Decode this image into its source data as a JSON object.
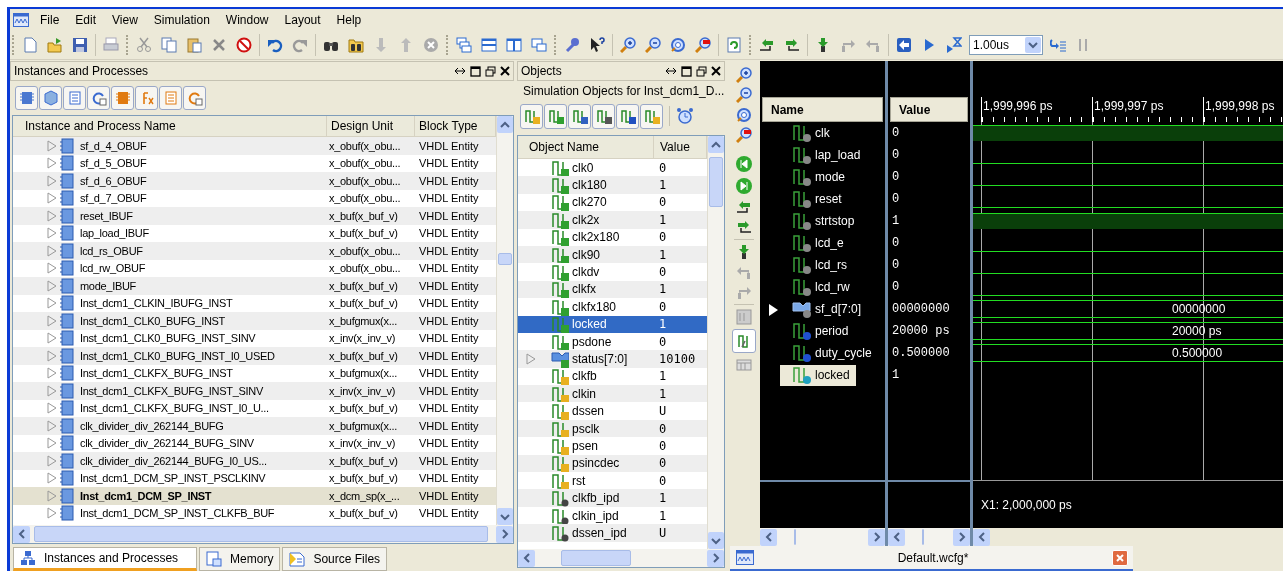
{
  "menu": [
    "File",
    "Edit",
    "View",
    "Simulation",
    "Window",
    "Layout",
    "Help"
  ],
  "toolbar": {
    "time_step": "1.00us"
  },
  "instances": {
    "title": "Instances and Processes",
    "columns": [
      "Instance and Process Name",
      "Design Unit",
      "Block Type"
    ],
    "rows": [
      {
        "name": "sf_d_4_OBUF",
        "design_unit": "x_obuf(x_obu...",
        "block_type": "VHDL Entity",
        "selected": false
      },
      {
        "name": "sf_d_5_OBUF",
        "design_unit": "x_obuf(x_obu...",
        "block_type": "VHDL Entity",
        "selected": false
      },
      {
        "name": "sf_d_6_OBUF",
        "design_unit": "x_obuf(x_obu...",
        "block_type": "VHDL Entity",
        "selected": false
      },
      {
        "name": "sf_d_7_OBUF",
        "design_unit": "x_obuf(x_obu...",
        "block_type": "VHDL Entity",
        "selected": false
      },
      {
        "name": "reset_IBUF",
        "design_unit": "x_buf(x_buf_v)",
        "block_type": "VHDL Entity",
        "selected": false
      },
      {
        "name": "lap_load_IBUF",
        "design_unit": "x_buf(x_buf_v)",
        "block_type": "VHDL Entity",
        "selected": false
      },
      {
        "name": "lcd_rs_OBUF",
        "design_unit": "x_obuf(x_obu...",
        "block_type": "VHDL Entity",
        "selected": false
      },
      {
        "name": "lcd_rw_OBUF",
        "design_unit": "x_obuf(x_obu...",
        "block_type": "VHDL Entity",
        "selected": false
      },
      {
        "name": "mode_IBUF",
        "design_unit": "x_buf(x_buf_v)",
        "block_type": "VHDL Entity",
        "selected": false
      },
      {
        "name": "Inst_dcm1_CLKIN_IBUFG_INST",
        "design_unit": "x_buf(x_buf_v)",
        "block_type": "VHDL Entity",
        "selected": false
      },
      {
        "name": "Inst_dcm1_CLK0_BUFG_INST",
        "design_unit": "x_bufgmux(x...",
        "block_type": "VHDL Entity",
        "selected": false
      },
      {
        "name": "Inst_dcm1_CLK0_BUFG_INST_SINV",
        "design_unit": "x_inv(x_inv_v)",
        "block_type": "VHDL Entity",
        "selected": false
      },
      {
        "name": "Inst_dcm1_CLK0_BUFG_INST_I0_USED",
        "design_unit": "x_buf(x_buf_v)",
        "block_type": "VHDL Entity",
        "selected": false
      },
      {
        "name": "Inst_dcm1_CLKFX_BUFG_INST",
        "design_unit": "x_bufgmux(x...",
        "block_type": "VHDL Entity",
        "selected": false
      },
      {
        "name": "Inst_dcm1_CLKFX_BUFG_INST_SINV",
        "design_unit": "x_inv(x_inv_v)",
        "block_type": "VHDL Entity",
        "selected": false
      },
      {
        "name": "Inst_dcm1_CLKFX_BUFG_INST_I0_U...",
        "design_unit": "x_buf(x_buf_v)",
        "block_type": "VHDL Entity",
        "selected": false
      },
      {
        "name": "clk_divider_div_262144_BUFG",
        "design_unit": "x_bufgmux(x...",
        "block_type": "VHDL Entity",
        "selected": false
      },
      {
        "name": "clk_divider_div_262144_BUFG_SINV",
        "design_unit": "x_inv(x_inv_v)",
        "block_type": "VHDL Entity",
        "selected": false
      },
      {
        "name": "clk_divider_div_262144_BUFG_I0_US...",
        "design_unit": "x_buf(x_buf_v)",
        "block_type": "VHDL Entity",
        "selected": false
      },
      {
        "name": "Inst_dcm1_DCM_SP_INST_PSCLKINV",
        "design_unit": "x_buf(x_buf_v)",
        "block_type": "VHDL Entity",
        "selected": false
      },
      {
        "name": "Inst_dcm1_DCM_SP_INST",
        "design_unit": "x_dcm_sp(x_...",
        "block_type": "VHDL Entity",
        "selected": true
      },
      {
        "name": "Inst_dcm1_DCM_SP_INST_CLKFB_BUF",
        "design_unit": "x_buf(x_buf_v)",
        "block_type": "VHDL Entity",
        "selected": false
      }
    ]
  },
  "left_tabs": [
    {
      "label": "Instances and Processes",
      "selected": true
    },
    {
      "label": "Memory",
      "selected": false
    },
    {
      "label": "Source Files",
      "selected": false
    }
  ],
  "objects": {
    "title": "Objects",
    "subtitle": "Simulation Objects for Inst_dcm1_D...",
    "columns": [
      "Object Name",
      "Value"
    ],
    "rows": [
      {
        "name": "clk0",
        "value": "0",
        "kind": "output",
        "selected": false
      },
      {
        "name": "clk180",
        "value": "1",
        "kind": "output",
        "selected": false
      },
      {
        "name": "clk270",
        "value": "0",
        "kind": "output",
        "selected": false
      },
      {
        "name": "clk2x",
        "value": "1",
        "kind": "output",
        "selected": false
      },
      {
        "name": "clk2x180",
        "value": "0",
        "kind": "output",
        "selected": false
      },
      {
        "name": "clk90",
        "value": "1",
        "kind": "output",
        "selected": false
      },
      {
        "name": "clkdv",
        "value": "0",
        "kind": "output",
        "selected": false
      },
      {
        "name": "clkfx",
        "value": "1",
        "kind": "output",
        "selected": false
      },
      {
        "name": "clkfx180",
        "value": "0",
        "kind": "output",
        "selected": false
      },
      {
        "name": "locked",
        "value": "1",
        "kind": "output",
        "selected": true
      },
      {
        "name": "psdone",
        "value": "0",
        "kind": "output",
        "selected": false
      },
      {
        "name": "status[7:0]",
        "value": "10100",
        "kind": "bus",
        "selected": false
      },
      {
        "name": "clkfb",
        "value": "1",
        "kind": "input",
        "selected": false
      },
      {
        "name": "clkin",
        "value": "1",
        "kind": "input",
        "selected": false
      },
      {
        "name": "dssen",
        "value": "U",
        "kind": "input",
        "selected": false
      },
      {
        "name": "psclk",
        "value": "0",
        "kind": "input",
        "selected": false
      },
      {
        "name": "psen",
        "value": "0",
        "kind": "input",
        "selected": false
      },
      {
        "name": "psincdec",
        "value": "0",
        "kind": "input",
        "selected": false
      },
      {
        "name": "rst",
        "value": "0",
        "kind": "input",
        "selected": false
      },
      {
        "name": "clkfb_ipd",
        "value": "1",
        "kind": "internal",
        "selected": false
      },
      {
        "name": "clkin_ipd",
        "value": "1",
        "kind": "internal",
        "selected": false
      },
      {
        "name": "dssen_ipd",
        "value": "U",
        "kind": "internal",
        "selected": false
      }
    ]
  },
  "wave": {
    "columns": [
      "Name",
      "Value"
    ],
    "time_labels": [
      "1,999,996 ps",
      "1,999,997 ps",
      "1,999,998 ps"
    ],
    "signals": [
      {
        "name": "clk",
        "value": "0",
        "kind": "signal",
        "high": true,
        "selected": false
      },
      {
        "name": "lap_load",
        "value": "0",
        "kind": "signal",
        "high": false,
        "selected": false
      },
      {
        "name": "mode",
        "value": "0",
        "kind": "signal",
        "high": false,
        "selected": false
      },
      {
        "name": "reset",
        "value": "0",
        "kind": "signal",
        "high": false,
        "selected": false
      },
      {
        "name": "strtstop",
        "value": "1",
        "kind": "signal",
        "high": true,
        "selected": false
      },
      {
        "name": "lcd_e",
        "value": "0",
        "kind": "signal",
        "high": false,
        "selected": false
      },
      {
        "name": "lcd_rs",
        "value": "0",
        "kind": "signal",
        "high": false,
        "selected": false
      },
      {
        "name": "lcd_rw",
        "value": "0",
        "kind": "signal",
        "high": false,
        "selected": false
      },
      {
        "name": "sf_d[7:0]",
        "value": "00000000",
        "kind": "bus",
        "trace_label": "00000000",
        "selected": false
      },
      {
        "name": "period",
        "value": "20000 ps",
        "kind": "constant",
        "trace_label": "20000 ps",
        "selected": false
      },
      {
        "name": "duty_cycle",
        "value": "0.500000",
        "kind": "constant",
        "trace_label": "0.500000",
        "selected": false
      },
      {
        "name": "locked",
        "value": "1",
        "kind": "output",
        "selected": true
      }
    ],
    "cursor": "X1: 2,000,000 ps",
    "tab": "Default.wcfg*"
  }
}
